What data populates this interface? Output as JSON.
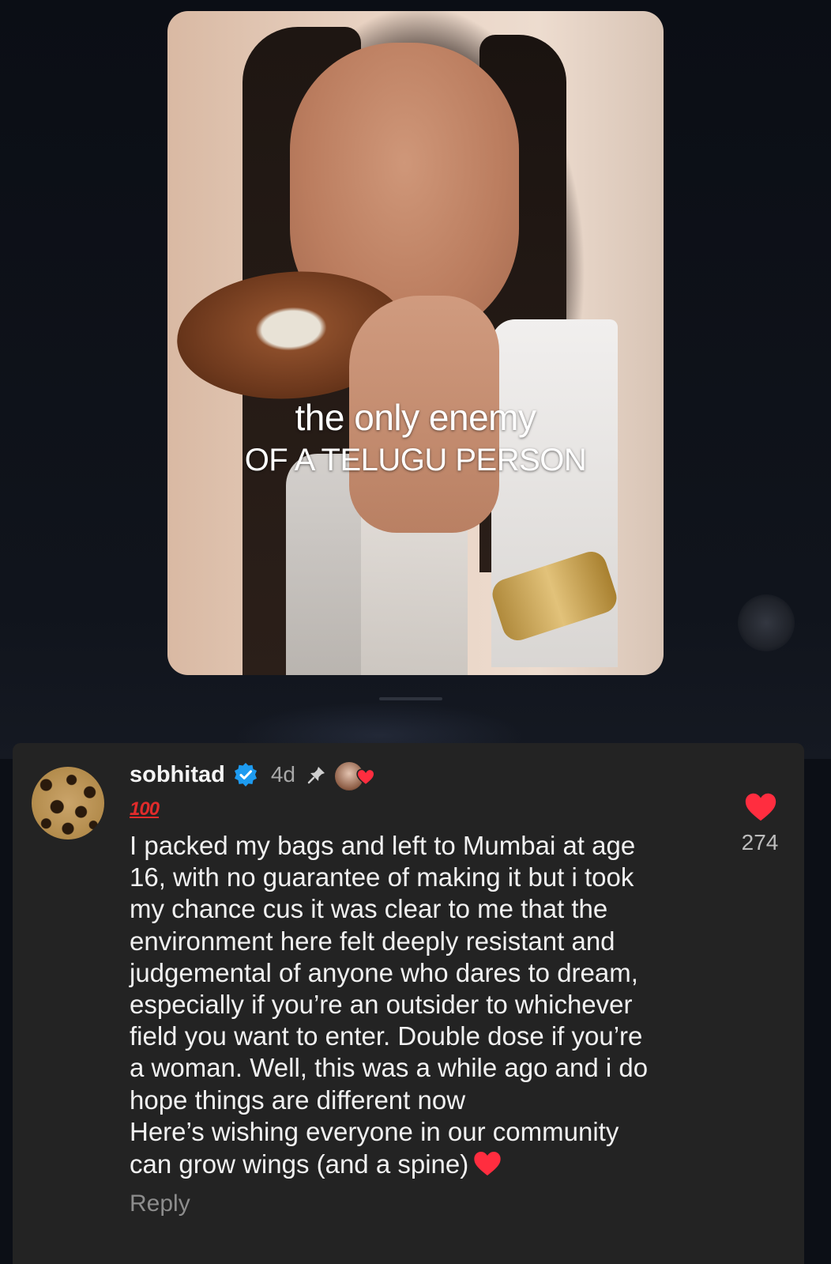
{
  "video": {
    "caption_line1": "the only enemy",
    "caption_line2": "OF A TELUGU PERSON"
  },
  "comment": {
    "username": "sobhitad",
    "verified_icon": "verified-badge-icon",
    "time": "4d",
    "pinned_icon": "pin-icon",
    "creator_liked_icon": "creator-heart-icon",
    "emoji": "100",
    "text": "I packed my bags and left to Mumbai at age\n16, with no guarantee of making it but i took\nmy chance cus it was clear to me that the\nenvironment here felt deeply resistant and\njudgemental of anyone who dares to dream,\nespecially if you’re an outsider to whichever\nfield you want to enter. Double dose if you’re\na woman. Well, this was a while ago and i do\nhope things are different now\nHere’s wishing everyone in our community\ncan grow wings (and a spine)",
    "like_count": "274",
    "reply_label": "Reply"
  },
  "colors": {
    "sheet_bg": "#232323",
    "page_bg": "#0c0f16",
    "accent_red": "#ff2d3f",
    "verified_blue": "#1d9bf0"
  }
}
